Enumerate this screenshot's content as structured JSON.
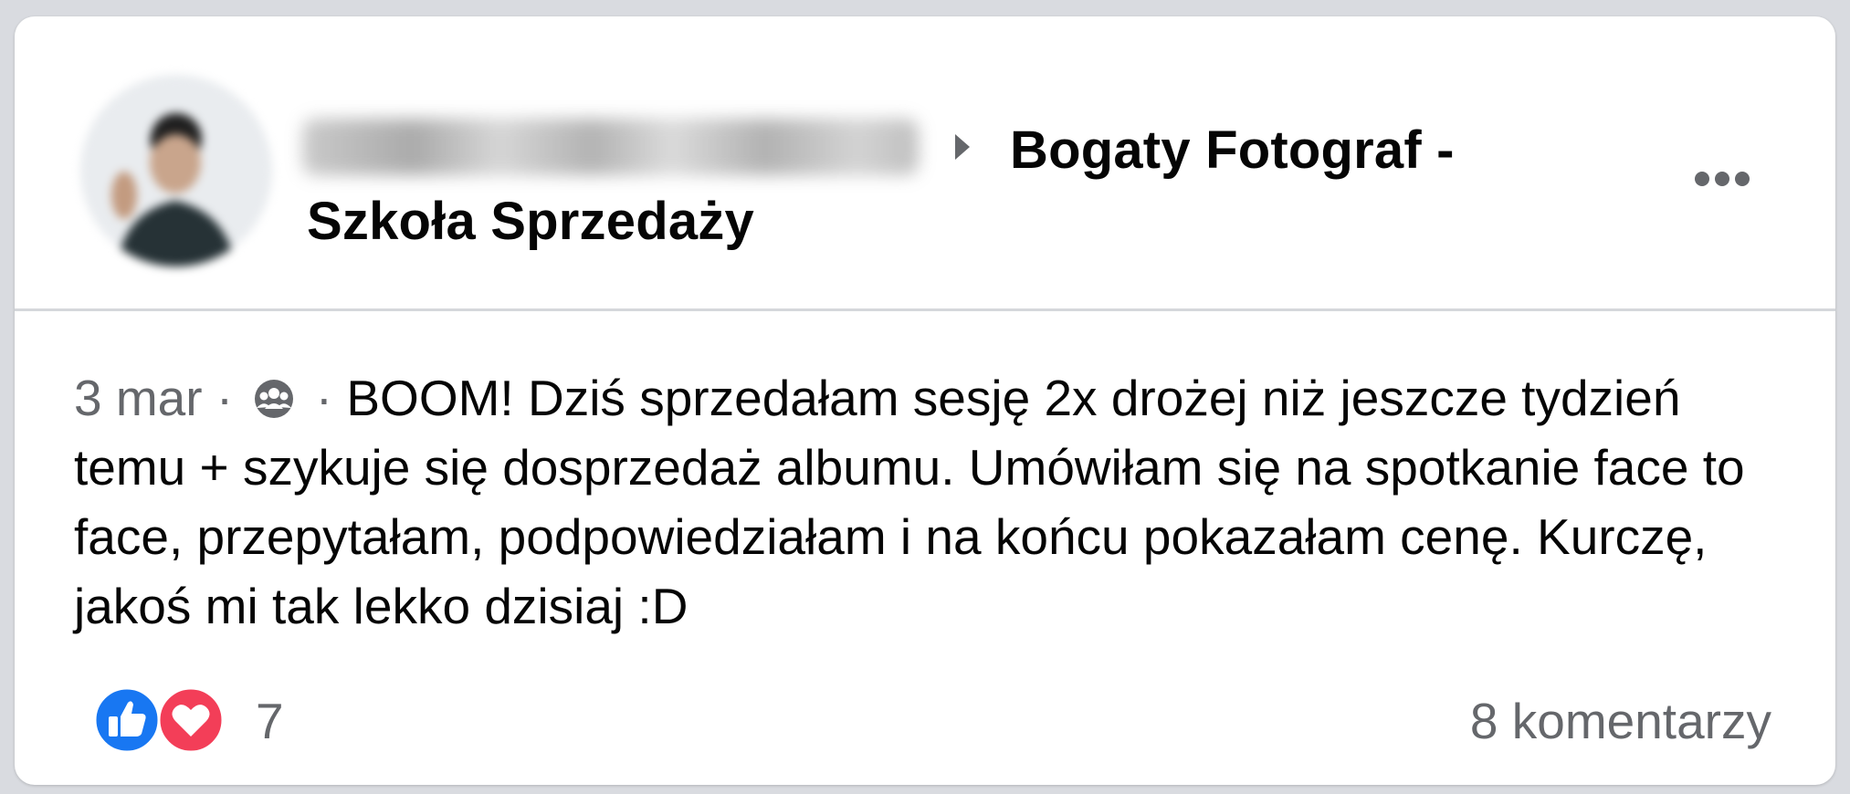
{
  "post": {
    "author_name_redacted": "",
    "group_name": "Bogaty Fotograf - Szkoła Sprzedaży",
    "date": "3 mar",
    "separator": "·",
    "audience_icon": "group-icon",
    "body": "BOOM! Dziś sprzedałam sesję 2x drożej niż jeszcze tydzień temu + szykuje się dosprzedaż albumu. Umówiłam się na spotkanie face to face, przepytałam, podpowiedziałam i na końcu pokazałam cenę. Kurczę, jakoś mi tak lekko dzisiaj :D",
    "more_icon": "more-options-icon"
  },
  "footer": {
    "reactions": [
      "like-icon",
      "love-icon"
    ],
    "reaction_count": "7",
    "comments_label": "8 komentarzy"
  },
  "colors": {
    "like_blue": "#1877f2",
    "love_red": "#f33e58",
    "secondary_text": "#65676b",
    "primary_text": "#050505"
  }
}
